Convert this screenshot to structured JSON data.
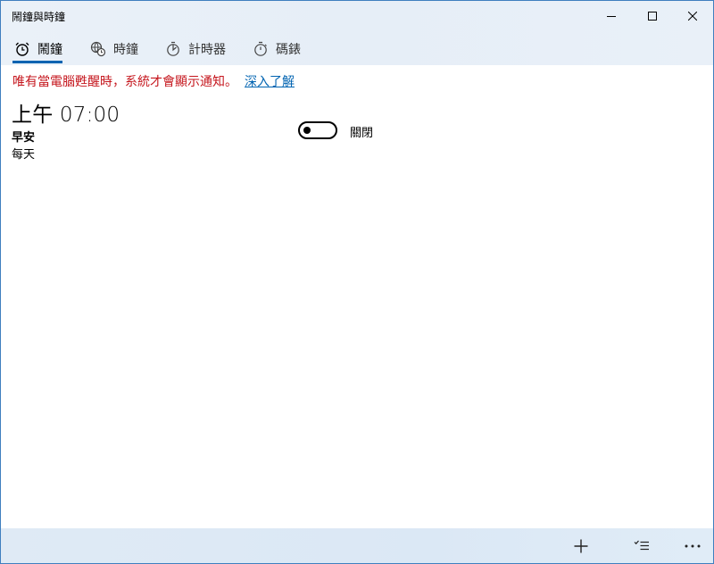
{
  "window": {
    "title": "鬧鐘與時鐘"
  },
  "tabs": [
    {
      "label": "鬧鐘",
      "icon": "alarm-clock-icon",
      "active": true
    },
    {
      "label": "時鐘",
      "icon": "world-clock-icon",
      "active": false
    },
    {
      "label": "計時器",
      "icon": "timer-icon",
      "active": false
    },
    {
      "label": "碼錶",
      "icon": "stopwatch-icon",
      "active": false
    }
  ],
  "notice": {
    "text": "唯有當電腦甦醒時，系統才會顯示通知。",
    "link": "深入了解"
  },
  "alarms": [
    {
      "time": "上午 07:00",
      "name": "早安",
      "repeat": "每天",
      "toggle_label": "關閉",
      "enabled": false
    }
  ],
  "command_bar": {
    "icons": [
      "add-icon",
      "select-multiple-icon",
      "more-icon"
    ]
  },
  "colors": {
    "accent": "#0063b1",
    "notice_red": "#c5161d",
    "window_border": "#3f7fbf"
  }
}
